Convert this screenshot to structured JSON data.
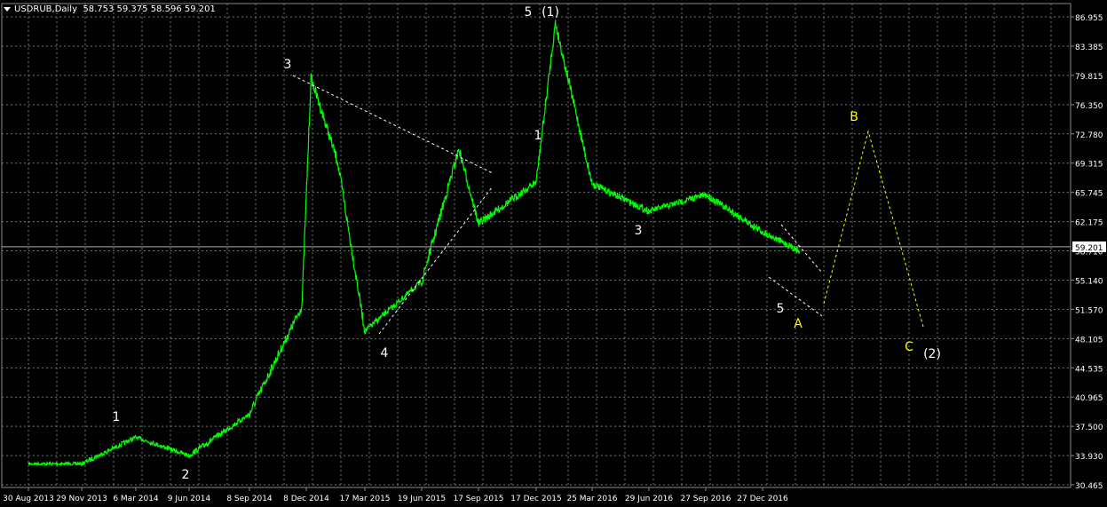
{
  "window": {
    "symbol": "USDRUB",
    "timeframe": "Daily",
    "quote": "58.753 59.375 58.596 59.201"
  },
  "colors": {
    "background": "#000000",
    "price_line": "#00ff00",
    "grid": "#6b7a6b",
    "axis_text": "#ffffff",
    "wave_white": "#ffffff",
    "wave_yellow": "#ffff00",
    "current_price_line": "#b0b0b0"
  },
  "chart_data": {
    "type": "line",
    "symbol": "USDRUB",
    "timeframe": "Daily",
    "price_axis": {
      "ticks": [
        "86.955",
        "83.385",
        "79.815",
        "76.350",
        "72.780",
        "69.315",
        "65.745",
        "62.175",
        "58.710",
        "55.140",
        "51.570",
        "48.105",
        "44.535",
        "40.965",
        "37.500",
        "33.930",
        "30.465"
      ],
      "range": [
        30.465,
        86.955
      ],
      "current_price_label": "59.201"
    },
    "time_axis": {
      "ticks": [
        "30 Aug 2013",
        "29 Nov 2013",
        "6 Mar 2014",
        "9 Jun 2014",
        "8 Sep 2014",
        "8 Dec 2014",
        "17 Mar 2015",
        "19 Jun 2015",
        "17 Sep 2015",
        "17 Dec 2015",
        "25 Mar 2016",
        "29 Jun 2016",
        "27 Sep 2016",
        "27 Dec 2016"
      ]
    },
    "grid": true,
    "series": [
      {
        "x": [
          "30 Aug 2013",
          "29 Nov 2013",
          "6 Mar 2014",
          "9 Jun 2014",
          "8 Sep 2014",
          "1 Dec 2014",
          "16 Dec 2014",
          "30 Jan 2015",
          "17 Mar 2015",
          "19 Jun 2015",
          "17 Aug 2015",
          "17 Sep 2015",
          "17 Dec 2015",
          "20 Jan 2016",
          "25 Mar 2016",
          "29 Jun 2016",
          "27 Sep 2016",
          "27 Dec 2016",
          "24 Feb 2017"
        ],
        "values": [
          33.0,
          33.0,
          36.2,
          34.0,
          39.0,
          52.0,
          79.6,
          69.5,
          49.0,
          55.0,
          71.0,
          62.0,
          67.0,
          86.2,
          66.8,
          63.5,
          65.5,
          61.0,
          58.7
        ]
      }
    ],
    "wave_labels": {
      "white": [
        "5",
        "(1)",
        "3",
        "1",
        "4",
        "3",
        "1",
        "2",
        "5",
        "(2)"
      ],
      "yellow": [
        "B",
        "A",
        "C"
      ]
    }
  }
}
